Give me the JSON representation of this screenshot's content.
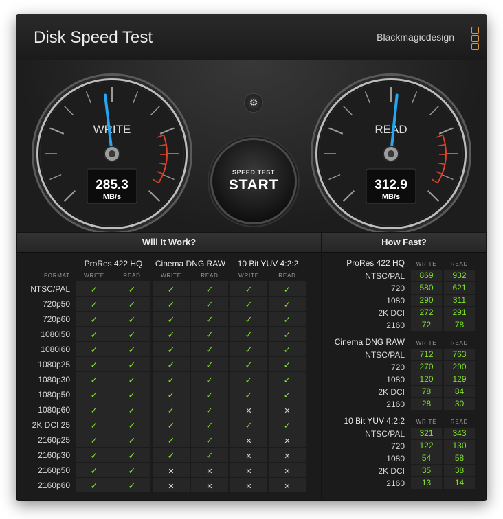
{
  "window": {
    "title": "Disk Speed Test",
    "brand": "Blackmagicdesign",
    "close_glyph": "×"
  },
  "colors": {
    "accent": "#e39331",
    "check": "#7fe12a",
    "needle": "#27a6f0",
    "redline": "#d9432b"
  },
  "gauges": {
    "write": {
      "label": "WRITE",
      "value": "285.3",
      "unit": "MB/s",
      "max_value": 600
    },
    "read": {
      "label": "READ",
      "value": "312.9",
      "unit": "MB/s",
      "max_value": 600
    }
  },
  "controls": {
    "settings_icon": "gear-icon",
    "settings_glyph": "⚙",
    "start_small": "SPEED TEST",
    "start_big": "START"
  },
  "will_it_work": {
    "title": "Will It Work?",
    "format_header": "FORMAT",
    "groups": [
      "ProRes 422 HQ",
      "Cinema DNG RAW",
      "10 Bit YUV 4:2:2"
    ],
    "sub_headers": [
      "WRITE",
      "READ"
    ],
    "check_glyph": "✓",
    "cross_glyph": "✕",
    "rows": [
      {
        "format": "NTSC/PAL",
        "results": [
          1,
          1,
          1,
          1,
          1,
          1
        ]
      },
      {
        "format": "720p50",
        "results": [
          1,
          1,
          1,
          1,
          1,
          1
        ]
      },
      {
        "format": "720p60",
        "results": [
          1,
          1,
          1,
          1,
          1,
          1
        ]
      },
      {
        "format": "1080i50",
        "results": [
          1,
          1,
          1,
          1,
          1,
          1
        ]
      },
      {
        "format": "1080i60",
        "results": [
          1,
          1,
          1,
          1,
          1,
          1
        ]
      },
      {
        "format": "1080p25",
        "results": [
          1,
          1,
          1,
          1,
          1,
          1
        ]
      },
      {
        "format": "1080p30",
        "results": [
          1,
          1,
          1,
          1,
          1,
          1
        ]
      },
      {
        "format": "1080p50",
        "results": [
          1,
          1,
          1,
          1,
          1,
          1
        ]
      },
      {
        "format": "1080p60",
        "results": [
          1,
          1,
          1,
          1,
          0,
          0
        ]
      },
      {
        "format": "2K DCI 25",
        "results": [
          1,
          1,
          1,
          1,
          1,
          1
        ]
      },
      {
        "format": "2160p25",
        "results": [
          1,
          1,
          1,
          1,
          0,
          0
        ]
      },
      {
        "format": "2160p30",
        "results": [
          1,
          1,
          1,
          1,
          0,
          0
        ]
      },
      {
        "format": "2160p50",
        "results": [
          1,
          1,
          0,
          0,
          0,
          0
        ]
      },
      {
        "format": "2160p60",
        "results": [
          1,
          1,
          0,
          0,
          0,
          0
        ]
      }
    ]
  },
  "how_fast": {
    "title": "How Fast?",
    "sub_headers": [
      "WRITE",
      "READ"
    ],
    "groups": [
      {
        "name": "ProRes 422 HQ",
        "rows": [
          {
            "format": "NTSC/PAL",
            "write": "869",
            "read": "932"
          },
          {
            "format": "720",
            "write": "580",
            "read": "621"
          },
          {
            "format": "1080",
            "write": "290",
            "read": "311"
          },
          {
            "format": "2K DCI",
            "write": "272",
            "read": "291"
          },
          {
            "format": "2160",
            "write": "72",
            "read": "78"
          }
        ]
      },
      {
        "name": "Cinema DNG RAW",
        "rows": [
          {
            "format": "NTSC/PAL",
            "write": "712",
            "read": "763"
          },
          {
            "format": "720",
            "write": "270",
            "read": "290"
          },
          {
            "format": "1080",
            "write": "120",
            "read": "129"
          },
          {
            "format": "2K DCI",
            "write": "78",
            "read": "84"
          },
          {
            "format": "2160",
            "write": "28",
            "read": "30"
          }
        ]
      },
      {
        "name": "10 Bit YUV 4:2:2",
        "rows": [
          {
            "format": "NTSC/PAL",
            "write": "321",
            "read": "343"
          },
          {
            "format": "720",
            "write": "122",
            "read": "130"
          },
          {
            "format": "1080",
            "write": "54",
            "read": "58"
          },
          {
            "format": "2K DCI",
            "write": "35",
            "read": "38"
          },
          {
            "format": "2160",
            "write": "13",
            "read": "14"
          }
        ]
      }
    ]
  }
}
